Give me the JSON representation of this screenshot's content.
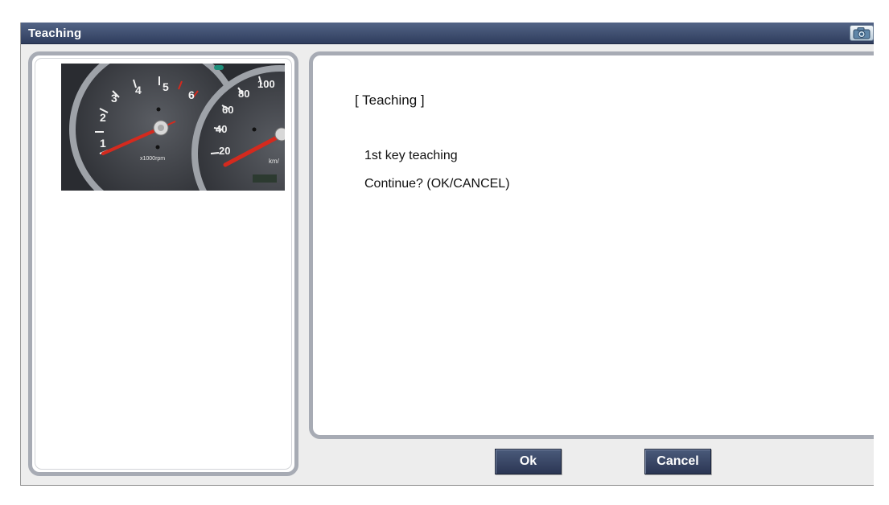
{
  "window": {
    "title": "Teaching"
  },
  "message": {
    "heading": "[ Teaching ]",
    "line1": "1st key teaching",
    "line2": "Continue? (OK/CANCEL)"
  },
  "buttons": {
    "ok_label": "Ok",
    "cancel_label": "Cancel"
  },
  "image": {
    "tachometer_labels": [
      "1",
      "2",
      "3",
      "4",
      "5",
      "6"
    ],
    "tachometer_unit": "x1000rpm",
    "speedometer_labels": [
      "20",
      "40",
      "60",
      "80",
      "100"
    ],
    "speedometer_unit": "km/"
  },
  "icons": {
    "titlebar_right": "camera-icon"
  },
  "colors": {
    "titlebar": "#3a4867",
    "button": "#34405e",
    "panel_border": "#a7abb4",
    "needle": "#d42a1e"
  }
}
